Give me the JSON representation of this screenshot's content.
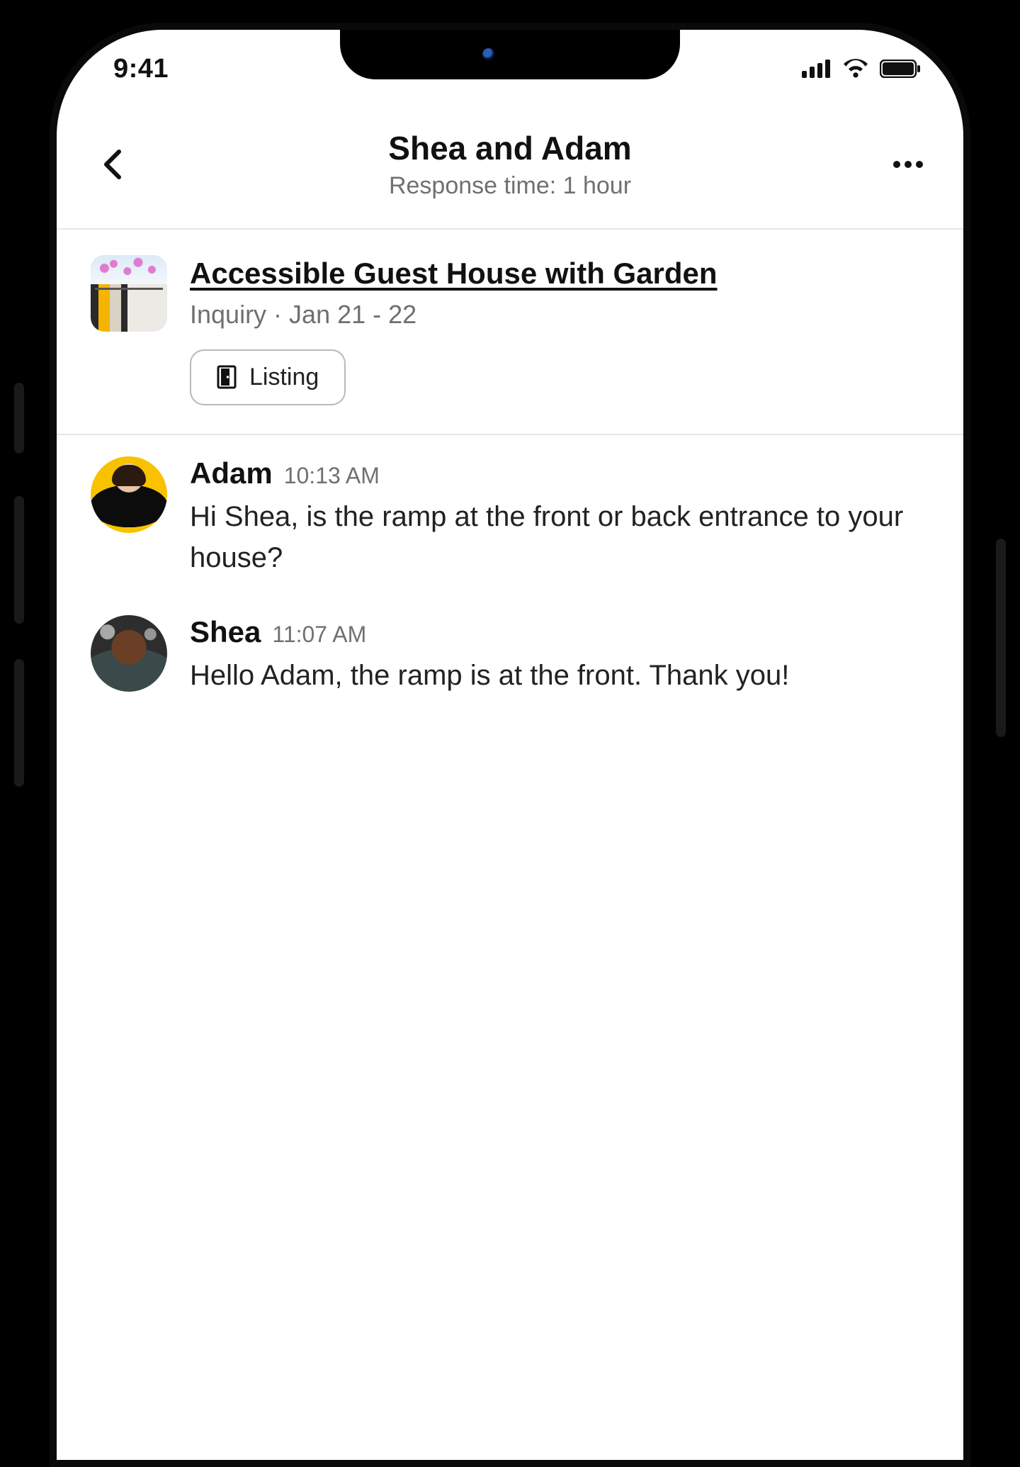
{
  "status_bar": {
    "time": "9:41"
  },
  "header": {
    "title": "Shea and Adam",
    "subtitle": "Response time: 1 hour"
  },
  "listing": {
    "title": "Accessible Guest House with Garden",
    "meta": "Inquiry · Jan 21 - 22",
    "button_label": "Listing"
  },
  "messages": [
    {
      "sender": "Adam",
      "time": "10:13 AM",
      "text": "Hi Shea, is the ramp at the front or back entrance to your house?",
      "avatar": "adam"
    },
    {
      "sender": "Shea",
      "time": "11:07 AM",
      "text": "Hello Adam, the ramp is at the front. Thank you!",
      "avatar": "shea"
    }
  ]
}
